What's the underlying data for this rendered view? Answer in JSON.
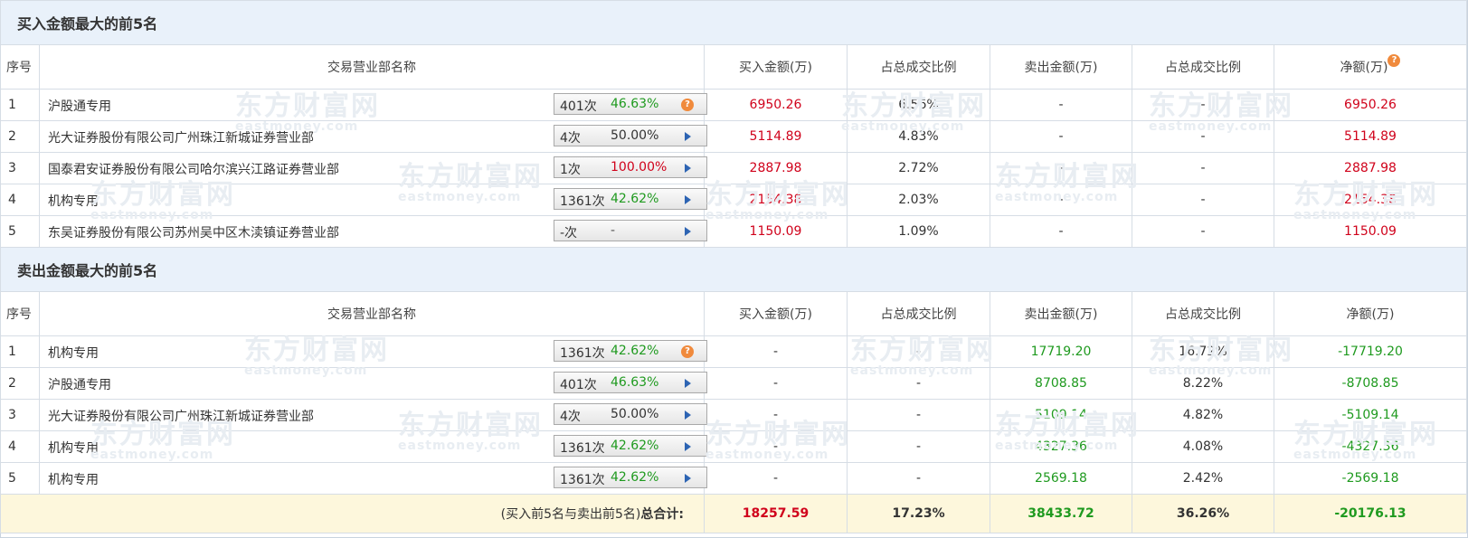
{
  "buy_top5": {
    "title": "买入金额最大的前5名",
    "headers": [
      "序号",
      "交易营业部名称",
      "买入金额(万)",
      "占总成交比例",
      "卖出金额(万)",
      "占总成交比例",
      "净额(万)"
    ],
    "help_icon": "help-icon",
    "rows": [
      {
        "seq": "1",
        "name": "沪股通专用",
        "count": "401次",
        "rate": "46.63%",
        "rate_color": "#1f9a1f",
        "action_icon": "help-icon",
        "buy": "6950.26",
        "buy_pct": "6.56%",
        "sell": "-",
        "sell_pct": "-",
        "net": "6950.26"
      },
      {
        "seq": "2",
        "name": "光大证券股份有限公司广州珠江新城证券营业部",
        "count": "4次",
        "rate": "50.00%",
        "rate_color": "#333333",
        "action_icon": "play-icon",
        "buy": "5114.89",
        "buy_pct": "4.83%",
        "sell": "-",
        "sell_pct": "-",
        "net": "5114.89"
      },
      {
        "seq": "3",
        "name": "国泰君安证券股份有限公司哈尔滨兴江路证券营业部",
        "count": "1次",
        "rate": "100.00%",
        "rate_color": "#d0021b",
        "action_icon": "play-icon",
        "buy": "2887.98",
        "buy_pct": "2.72%",
        "sell": "-",
        "sell_pct": "-",
        "net": "2887.98"
      },
      {
        "seq": "4",
        "name": "机构专用",
        "count": "1361次",
        "rate": "42.62%",
        "rate_color": "#1f9a1f",
        "action_icon": "play-icon",
        "buy": "2154.38",
        "buy_pct": "2.03%",
        "sell": "-",
        "sell_pct": "-",
        "net": "2154.38"
      },
      {
        "seq": "5",
        "name": "东吴证券股份有限公司苏州吴中区木渎镇证券营业部",
        "count": "-次",
        "rate": "-",
        "rate_color": "#555555",
        "action_icon": "play-icon",
        "buy": "1150.09",
        "buy_pct": "1.09%",
        "sell": "-",
        "sell_pct": "-",
        "net": "1150.09"
      }
    ]
  },
  "sell_top5": {
    "title": "卖出金额最大的前5名",
    "headers": [
      "序号",
      "交易营业部名称",
      "买入金额(万)",
      "占总成交比例",
      "卖出金额(万)",
      "占总成交比例",
      "净额(万)"
    ],
    "rows": [
      {
        "seq": "1",
        "name": "机构专用",
        "count": "1361次",
        "rate": "42.62%",
        "rate_color": "#1f9a1f",
        "action_icon": "help-icon",
        "buy": "-",
        "buy_pct": "-",
        "sell": "17719.20",
        "sell_pct": "16.72%",
        "net": "-17719.20"
      },
      {
        "seq": "2",
        "name": "沪股通专用",
        "count": "401次",
        "rate": "46.63%",
        "rate_color": "#1f9a1f",
        "action_icon": "play-icon",
        "buy": "-",
        "buy_pct": "-",
        "sell": "8708.85",
        "sell_pct": "8.22%",
        "net": "-8708.85"
      },
      {
        "seq": "3",
        "name": "光大证券股份有限公司广州珠江新城证券营业部",
        "count": "4次",
        "rate": "50.00%",
        "rate_color": "#333333",
        "action_icon": "play-icon",
        "buy": "-",
        "buy_pct": "-",
        "sell": "5109.14",
        "sell_pct": "4.82%",
        "net": "-5109.14"
      },
      {
        "seq": "4",
        "name": "机构专用",
        "count": "1361次",
        "rate": "42.62%",
        "rate_color": "#1f9a1f",
        "action_icon": "play-icon",
        "buy": "-",
        "buy_pct": "-",
        "sell": "4327.36",
        "sell_pct": "4.08%",
        "net": "-4327.36"
      },
      {
        "seq": "5",
        "name": "机构专用",
        "count": "1361次",
        "rate": "42.62%",
        "rate_color": "#1f9a1f",
        "action_icon": "play-icon",
        "buy": "-",
        "buy_pct": "-",
        "sell": "2569.18",
        "sell_pct": "2.42%",
        "net": "-2569.18"
      }
    ]
  },
  "total": {
    "label_prefix": "(买入前5名与卖出前5名)",
    "label_suffix": "总合计:",
    "buy": "18257.59",
    "buy_pct": "17.23%",
    "sell": "38433.72",
    "sell_pct": "36.26%",
    "net": "-20176.13"
  },
  "watermark": {
    "brand": "东方财富网",
    "domain": "eastmoney.com"
  },
  "colors": {
    "buy": "#d0021b",
    "sell": "#1f9a1f",
    "section_bg": "#e9f1fa",
    "total_bg": "#fdf7dc"
  }
}
